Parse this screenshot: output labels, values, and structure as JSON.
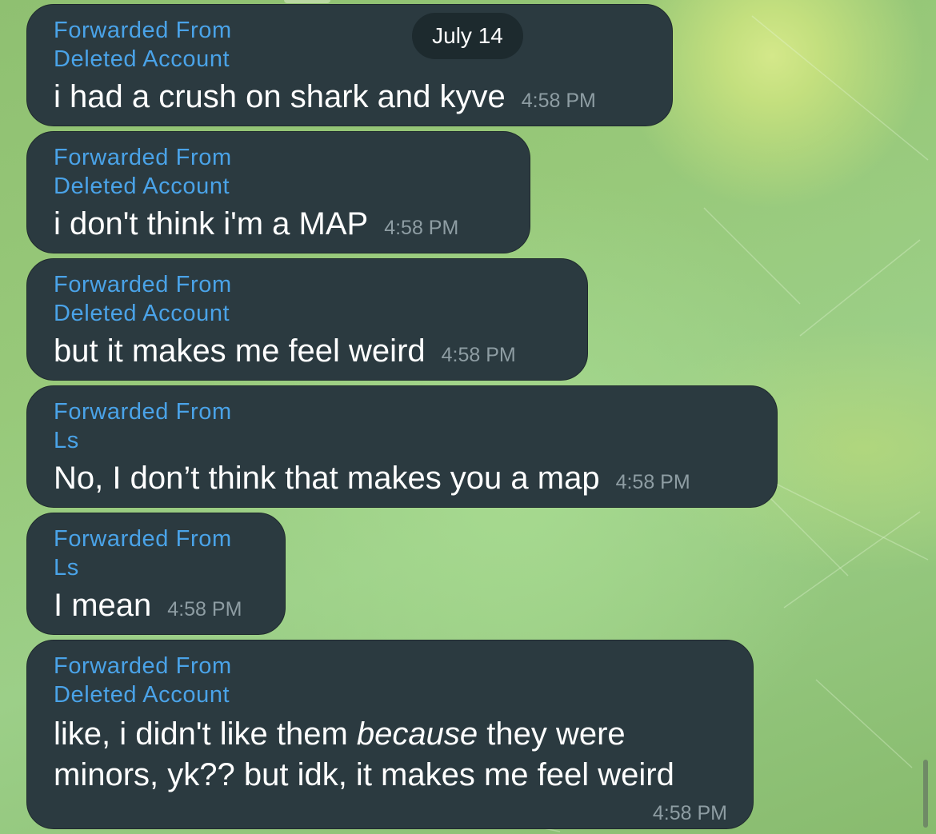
{
  "chat": {
    "date_badge": "July 14",
    "messages": [
      {
        "forwarded_label": "Forwarded From",
        "sender": "Deleted Account",
        "text": "i had a crush on shark and kyve",
        "time": "4:58 PM"
      },
      {
        "forwarded_label": "Forwarded From",
        "sender": "Deleted Account",
        "text": "i don't think i'm a MAP",
        "time": "4:58 PM"
      },
      {
        "forwarded_label": "Forwarded From",
        "sender": "Deleted Account",
        "text": "but it makes me feel weird",
        "time": "4:58 PM"
      },
      {
        "forwarded_label": "Forwarded From",
        "sender": "Ls",
        "text": "No, I don’t think that makes you a map",
        "time": "4:58 PM"
      },
      {
        "forwarded_label": "Forwarded From",
        "sender": "Ls",
        "text": "I mean",
        "time": "4:58 PM"
      },
      {
        "forwarded_label": "Forwarded From",
        "sender": "Deleted Account",
        "text_before": "like, i didn't like them ",
        "text_emphasis": "because",
        "text_after": " they were",
        "text_line2": "minors, yk?? but idk, it makes me feel weird",
        "time": "4:58 PM"
      }
    ]
  },
  "colors": {
    "bubble": "#2b3a40",
    "sender_link": "#4aa3e8",
    "timestamp": "#8e9da3",
    "background": "#98c97a"
  }
}
